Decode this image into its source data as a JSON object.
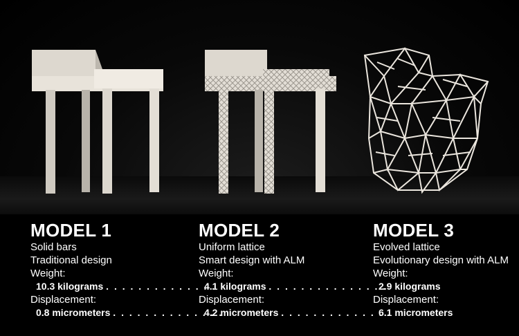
{
  "models": [
    {
      "title": "MODEL 1",
      "line1": "Solid bars",
      "line2": "Traditional design",
      "weight_label": "Weight:",
      "weight_value": "10.3 kilograms",
      "weight_dots": ". . . . . . . . . . . . . .",
      "disp_label": "Displacement:",
      "disp_value": "0.8 micrometers",
      "disp_dots": ". . . . . . . . . . . . . ."
    },
    {
      "title": "MODEL 2",
      "line1": "Uniform lattice",
      "line2": "Smart design with ALM",
      "weight_label": "Weight:",
      "weight_value": "4.1 kilograms",
      "weight_dots": ". . . . . . . . . . . . . . .",
      "disp_label": "Displacement:",
      "disp_value": "4.2 micrometers",
      "disp_dots": ". . . . . . . . . . . . . ."
    },
    {
      "title": "MODEL 3",
      "line1": "Evolved lattice",
      "line2": "Evolutionary design with ALM",
      "weight_label": "Weight:",
      "weight_value": "2.9 kilograms",
      "weight_dots": "",
      "disp_label": "Displacement:",
      "disp_value": "6.1 micrometers",
      "disp_dots": ""
    }
  ]
}
